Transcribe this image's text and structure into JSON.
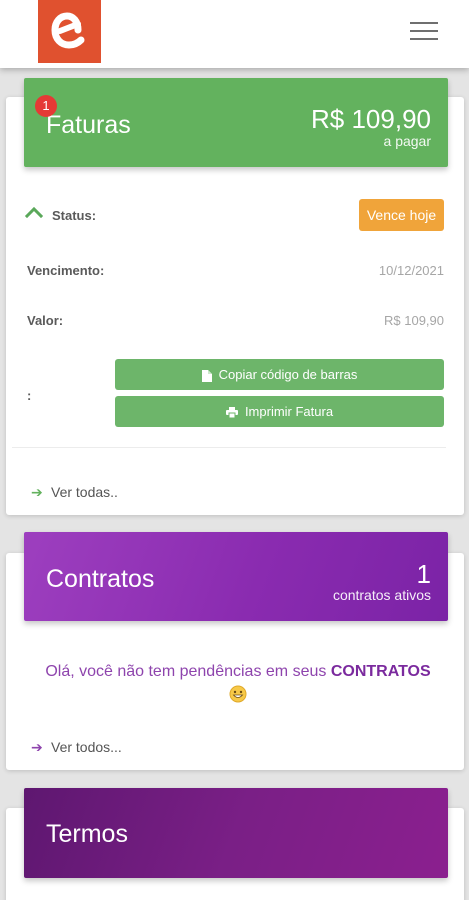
{
  "colors": {
    "brand": "#e0512f",
    "faturas": "#63b25e",
    "contratos": "#8a2bb0",
    "termos": "#6f1b7e",
    "warning": "#f0a43a"
  },
  "topbar": {
    "logo_icon": "e-logo",
    "menu_icon": "hamburger-icon"
  },
  "faturas": {
    "badge": "1",
    "title": "Faturas",
    "amount": "R$ 109,90",
    "amount_caption": "a pagar",
    "status_label": "Status:",
    "status_value": "Vence hoje",
    "vencimento_label": "Vencimento:",
    "vencimento_value": "10/12/2021",
    "valor_label": "Valor:",
    "valor_value": "R$ 109,90",
    "code_label": ":",
    "copy_button": "Copiar código de barras",
    "print_button": "Imprimir Fatura",
    "view_all": "Ver todas.."
  },
  "contratos": {
    "title": "Contratos",
    "count": "1",
    "count_caption": "contratos ativos",
    "message_prefix": "Olá, você não tem pendências em seus",
    "message_strong": "CONTRATOS",
    "view_all": "Ver todos..."
  },
  "termos": {
    "title": "Termos"
  }
}
